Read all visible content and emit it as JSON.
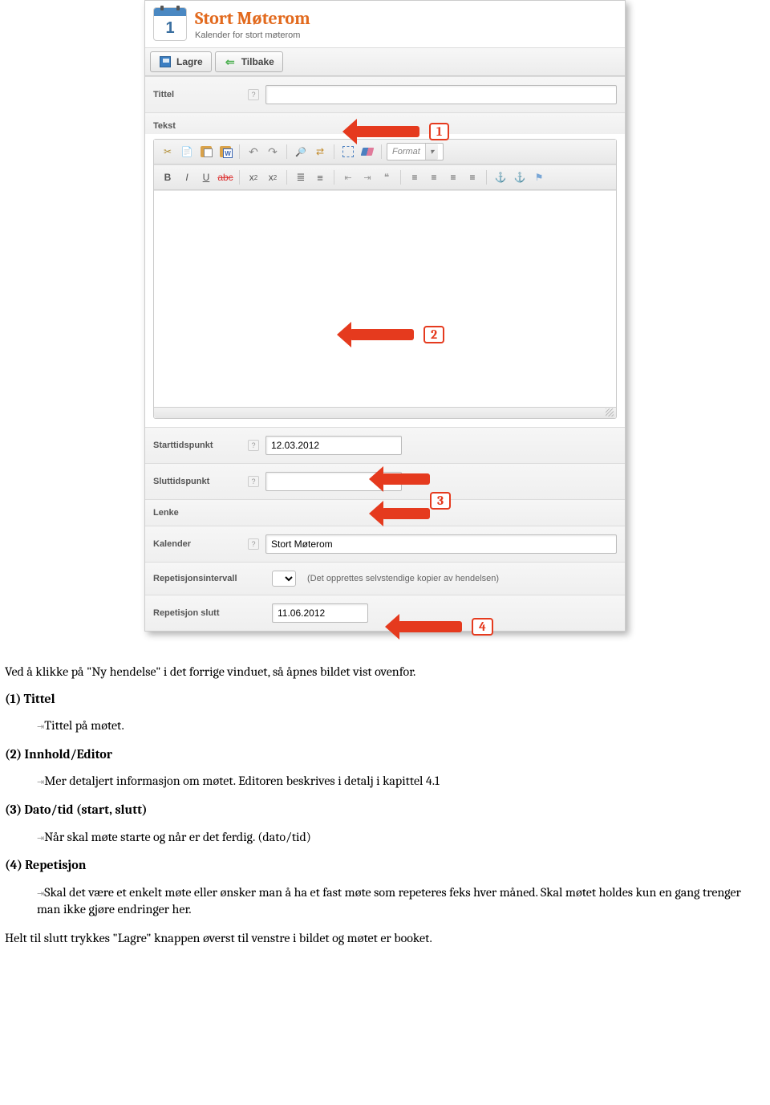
{
  "header": {
    "title": "Stort Møterom",
    "subtitle": "Kalender for stort møterom",
    "icon_number": "1"
  },
  "toolbar": {
    "save_label": "Lagre",
    "back_label": "Tilbake"
  },
  "form": {
    "title_label": "Tittel",
    "title_value": "",
    "text_label": "Tekst",
    "start_label": "Starttidspunkt",
    "start_value": "12.03.2012",
    "end_label": "Sluttidspunkt",
    "end_value": "",
    "link_label": "Lenke",
    "link_value": "",
    "calendar_label": "Kalender",
    "calendar_value": "Stort Møterom",
    "repeat_interval_label": "Repetisjonsintervall",
    "repeat_interval_hint": "(Det opprettes selvstendige kopier av hendelsen)",
    "repeat_end_label": "Repetisjon slutt",
    "repeat_end_value": "11.06.2012",
    "format_label": "Format"
  },
  "annotations": {
    "n1": "1",
    "n2": "2",
    "n3": "3",
    "n4": "4"
  },
  "doc": {
    "intro": "Ved å klikke på \"Ny hendelse\" i det forrige vinduet, så åpnes bildet vist ovenfor.",
    "s1_title": "(1) Tittel",
    "s1_body": "Tittel på møtet.",
    "s2_title": "(2) Innhold/Editor",
    "s2_body": "Mer detaljert informasjon om møtet. Editoren beskrives i detalj i kapittel 4.1",
    "s3_title": "(3) Dato/tid (start, slutt)",
    "s3_body": "Når skal møte starte og når er det ferdig. (dato/tid)",
    "s4_title": "(4) Repetisjon",
    "s4_body": "Skal det være et enkelt møte eller ønsker man å ha et fast møte som repeteres feks hver måned. Skal møtet holdes kun en gang trenger man ikke gjøre endringer her.",
    "outro": "Helt til slutt trykkes \"Lagre\" knappen øverst til venstre i bildet og møtet er booket."
  }
}
